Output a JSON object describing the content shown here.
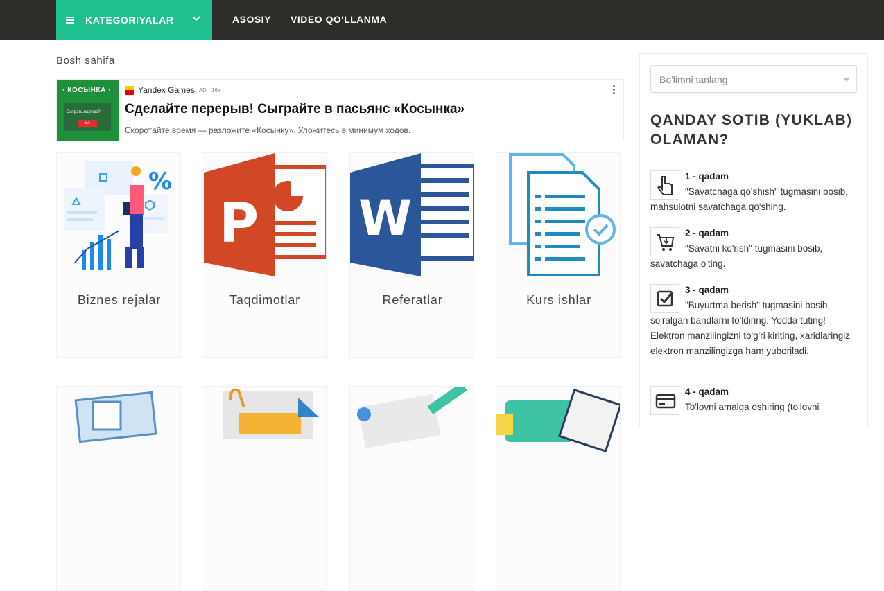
{
  "topbar": {
    "categories_label": "KATEGORIYALAR",
    "nav": [
      {
        "label": "ASOSIY"
      },
      {
        "label": "VIDEO QO'LLANMA"
      }
    ]
  },
  "breadcrumb": "Bosh sahifa",
  "ad": {
    "thumb_title": "· КОСЫНКА ·",
    "thumb_text": "Сыграть партию?",
    "thumb_button": "ДА",
    "brand": "Yandex Games",
    "tag": "AD · 16+",
    "title": "Сделайте перерыв! Сыграйте в пасьянс «Косынка»",
    "description": "Скоротайте время — разложите «Косынку». Уложитесь в минимум ходов."
  },
  "categories": [
    {
      "label": "Biznes rejalar",
      "icon": "business-illustration"
    },
    {
      "label": "Taqdimotlar",
      "icon": "powerpoint-icon"
    },
    {
      "label": "Referatlar",
      "icon": "word-icon"
    },
    {
      "label": "Kurs ishlar",
      "icon": "documents-icon"
    }
  ],
  "sidebar": {
    "select_placeholder": "Bo'limni tanlang",
    "title": "QANDAY SOTIB (YUKLAB) OLAMAN?",
    "steps": [
      {
        "number": "1 - qadam",
        "text": "\"Savatchaga qo'shish\" tugmasini bosib, mahsulotni savatchaga qo'shing.",
        "icon": "hand-pointer-icon"
      },
      {
        "number": "2 - qadam",
        "text": "\"Savatni ko'rish\" tugmasini bosib, savatchaga o'ting.",
        "icon": "cart-icon"
      },
      {
        "number": "3 - qadam",
        "text": "\"Buyurtma berish\" tugmasini bosib, so'ralgan bandlarni to'ldiring. Yodda tuting! Elektron manzilingizni to'g'ri kiriting, xaridlaringiz elektron manzilingizga ham yuboriladi.",
        "icon": "checkbox-icon"
      },
      {
        "number": "4 - qadam",
        "text": "To'lovni amalga oshiring (to'lovni",
        "icon": "credit-card-icon"
      }
    ]
  },
  "colors": {
    "topbar": "#2e2d29",
    "accent": "#1fbf8f",
    "ppt": "#d24726",
    "word": "#2b579a",
    "docs": "#1e8bc3"
  }
}
